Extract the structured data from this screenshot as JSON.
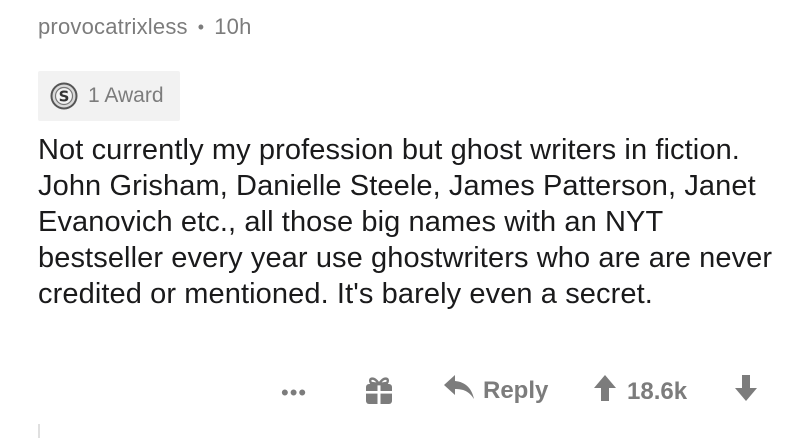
{
  "comment": {
    "username": "provocatrixless",
    "separator": "•",
    "timestamp": "10h",
    "award_label": "1 Award",
    "body": "Not currently my profession but ghost writers in fiction. John Grisham, Danielle Steele, James Patterson, Janet Evanovich etc., all those big names with an NYT bestseller every year use ghostwriters who are are never credited or mentioned. It's barely even a secret."
  },
  "actions": {
    "more_label": "•••",
    "reply_label": "Reply",
    "score": "18.6k"
  },
  "icons": {
    "award": "silver-award-icon",
    "gift": "gift-icon",
    "reply": "reply-arrow-icon",
    "upvote": "upvote-arrow-icon",
    "downvote": "downvote-arrow-icon"
  },
  "colors": {
    "text": "#1a1a1b",
    "muted": "#7c7c7c",
    "award_bg": "#f2f2f2"
  }
}
